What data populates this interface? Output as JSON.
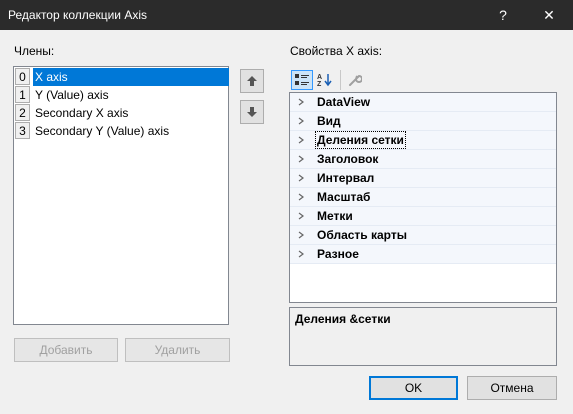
{
  "window": {
    "title": "Редактор коллекции Axis",
    "help_glyph": "?",
    "close_glyph": "✕"
  },
  "members": {
    "label": "Члены:",
    "items": [
      {
        "index": "0",
        "name": "X axis",
        "selected": true
      },
      {
        "index": "1",
        "name": "Y (Value) axis",
        "selected": false
      },
      {
        "index": "2",
        "name": "Secondary X axis",
        "selected": false
      },
      {
        "index": "3",
        "name": "Secondary Y (Value) axis",
        "selected": false
      }
    ],
    "add_label": "Добавить",
    "remove_label": "Удалить"
  },
  "properties": {
    "label": "Свойства X axis:",
    "categories": [
      {
        "name": "DataView"
      },
      {
        "name": "Вид"
      },
      {
        "name": "Деления сетки",
        "focused": true
      },
      {
        "name": "Заголовок"
      },
      {
        "name": "Интервал"
      },
      {
        "name": "Масштаб"
      },
      {
        "name": "Метки"
      },
      {
        "name": "Область карты"
      },
      {
        "name": "Разное"
      }
    ],
    "description_title": "Деления &сетки"
  },
  "footer": {
    "ok_label": "OK",
    "cancel_label": "Отмена"
  },
  "colors": {
    "titlebar": "#2b2b2b",
    "selection": "#0078d7",
    "dialog_bg": "#f0f0f0"
  }
}
